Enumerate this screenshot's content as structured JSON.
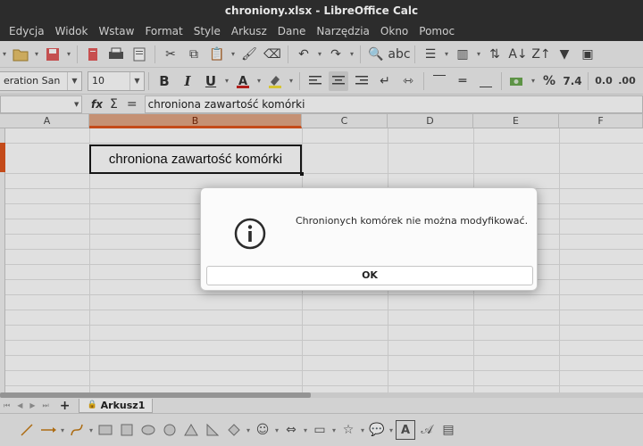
{
  "window": {
    "title": "chroniony.xlsx - LibreOffice Calc"
  },
  "menu": [
    "Edycja",
    "Widok",
    "Wstaw",
    "Format",
    "Style",
    "Arkusz",
    "Dane",
    "Narzędzia",
    "Okno",
    "Pomoc"
  ],
  "toolbar": {
    "font_name": "eration San",
    "font_size": "10",
    "format_number_label": "7.4"
  },
  "formula_bar": {
    "name_box": "",
    "fx": "fx",
    "sigma": "Σ",
    "equals": "=",
    "content": "chroniona zawartość komórki"
  },
  "grid": {
    "columns": [
      "A",
      "B",
      "C",
      "D",
      "E",
      "F"
    ],
    "selected_column": "B",
    "cell_b1": "chroniona zawartość komórki"
  },
  "sheets": {
    "add_label": "+",
    "tabs": [
      "Arkusz1"
    ]
  },
  "dialog": {
    "message": "Chronionych komórek nie można modyfikować.",
    "ok_label": "OK"
  }
}
